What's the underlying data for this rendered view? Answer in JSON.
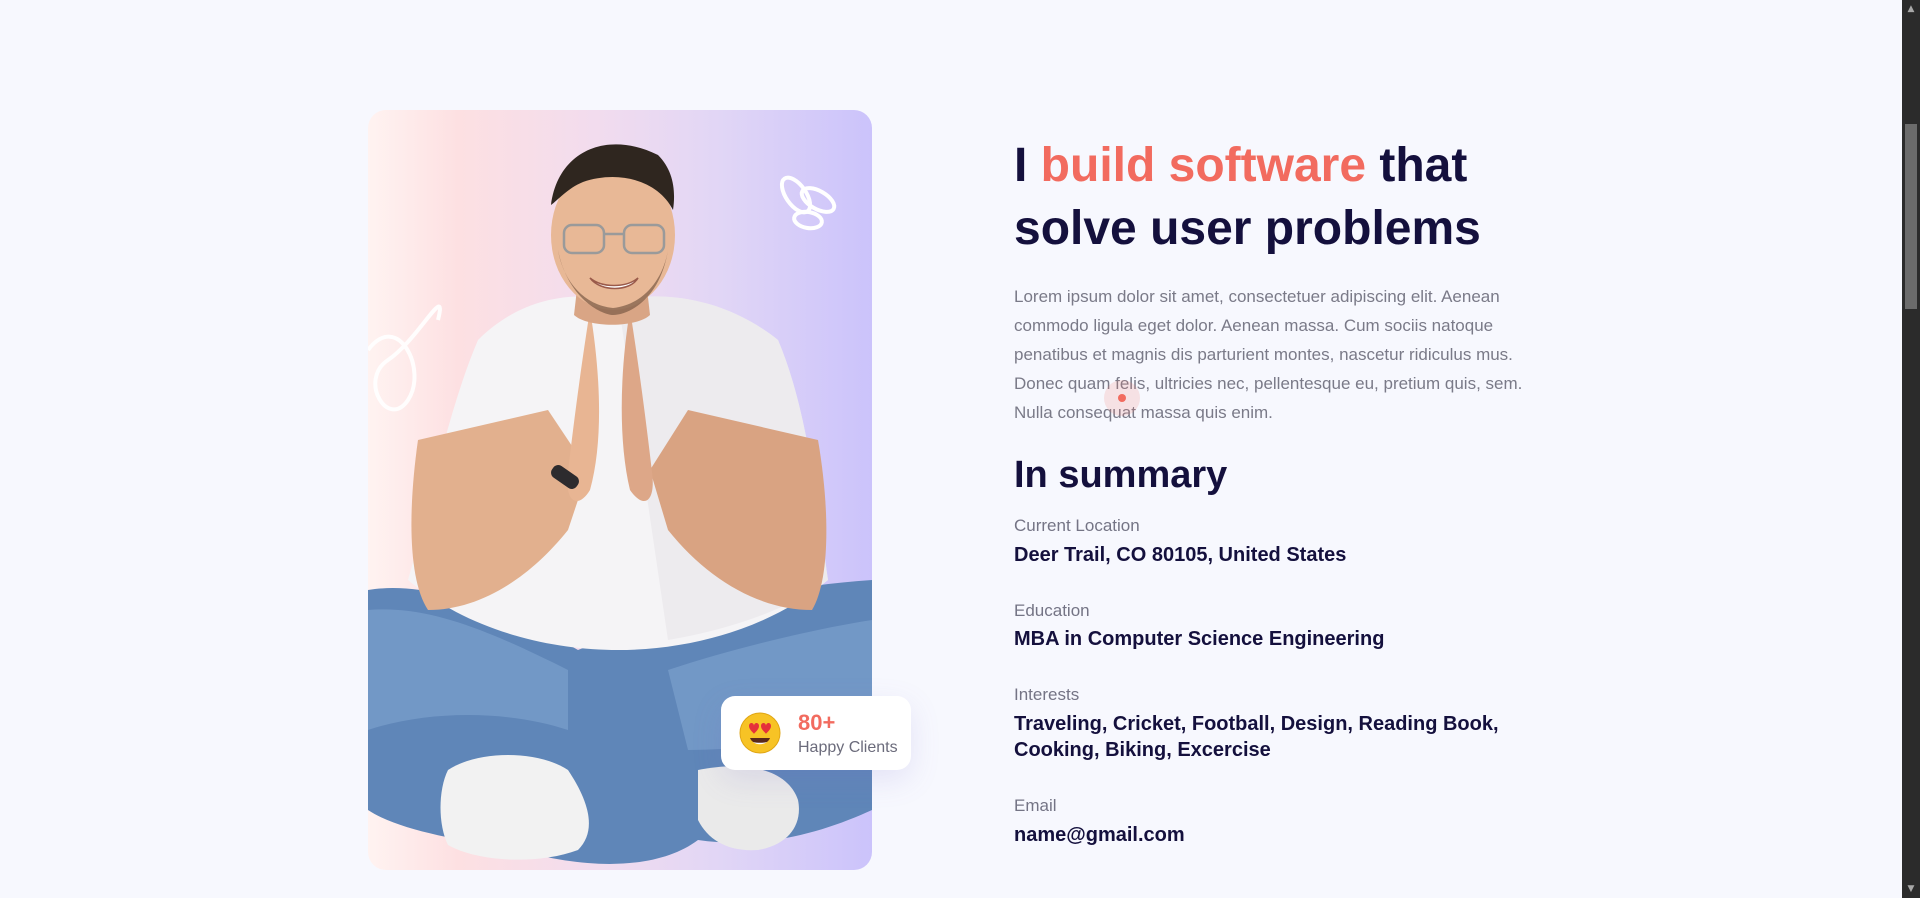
{
  "hero": {
    "heading_pre": "I ",
    "heading_accent": "build software",
    "heading_post": " that solve user problems",
    "description": "Lorem ipsum dolor sit amet, consectetuer adipiscing elit. Aenean commodo ligula eget dolor. Aenean massa. Cum sociis natoque penatibus et magnis dis parturient montes, nascetur ridiculus mus. Donec quam felis, ultricies nec, pellentesque eu, pretium quis, sem. Nulla consequat massa quis enim."
  },
  "badge": {
    "value": "80+",
    "label": "Happy Clients",
    "icon": "heart-eyes-emoji-icon"
  },
  "summary": {
    "title": "In summary",
    "items": [
      {
        "label": "Current Location",
        "value": "Deer Trail, CO 80105, United States"
      },
      {
        "label": "Education",
        "value": "MBA in Computer Science Engineering"
      },
      {
        "label": "Interests",
        "value": "Traveling, Cricket, Football, Design, Reading Book, Cooking, Biking, Excercise"
      },
      {
        "label": "Email",
        "value": "name@gmail.com"
      }
    ]
  },
  "colors": {
    "accent": "#f26b5f",
    "heading": "#14103d",
    "body_text": "#7a7a88",
    "background": "#f7f8fe"
  }
}
